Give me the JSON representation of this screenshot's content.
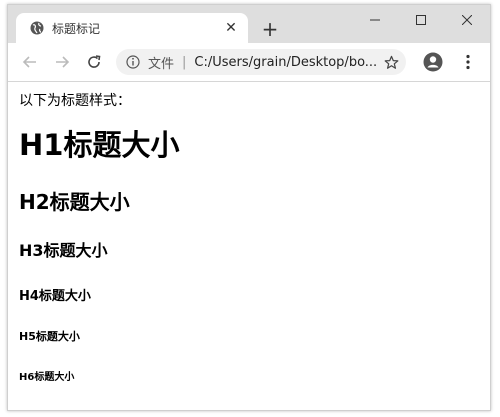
{
  "tab": {
    "title": "标题标记",
    "close_glyph": "✕"
  },
  "new_tab_glyph": "+",
  "window_controls": {
    "minimize": "—",
    "maximize": "☐",
    "close": "✕"
  },
  "address_bar": {
    "scheme_label": "文件",
    "separator": "|",
    "url": "C:/Users/grain/Desktop/bo..."
  },
  "page": {
    "intro": "以下为标题样式：",
    "headings": {
      "h1": "H1标题大小",
      "h2": "H2标题大小",
      "h3": "H3标题大小",
      "h4": "H4标题大小",
      "h5": "H5标题大小",
      "h6": "H6标题大小"
    }
  },
  "icons": {
    "favicon": "globe-icon",
    "back": "back-arrow-icon",
    "forward": "forward-arrow-icon",
    "reload": "reload-icon",
    "info": "info-icon",
    "bookmark": "star-icon",
    "profile": "profile-icon",
    "menu": "more-vert-icon"
  }
}
